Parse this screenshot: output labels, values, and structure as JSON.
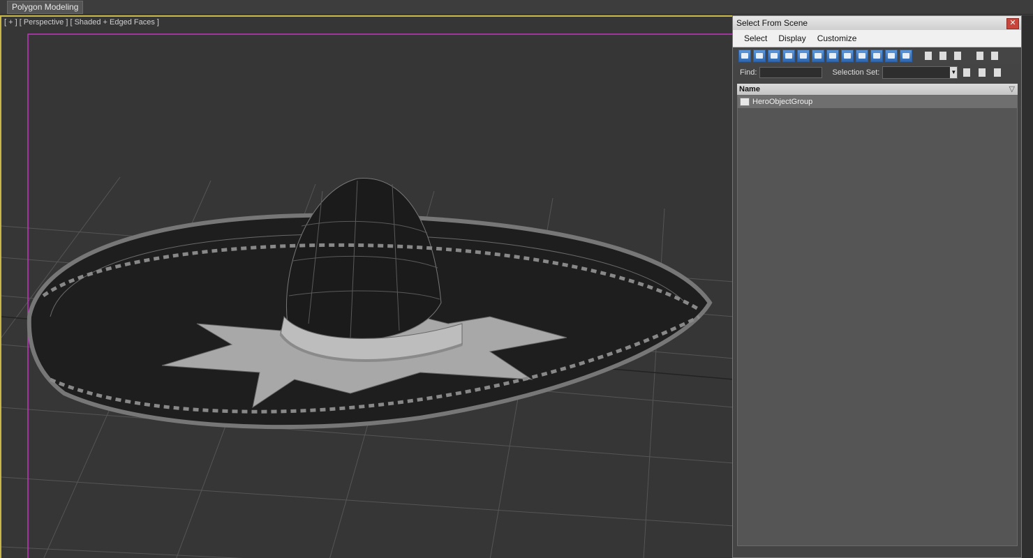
{
  "ribbon": {
    "active_tab": "Polygon Modeling"
  },
  "viewport": {
    "label": "[ + ] [ Perspective ] [ Shaded + Edged Faces ]"
  },
  "dialog": {
    "title": "Select From Scene",
    "close": "✕",
    "menus": [
      "Select",
      "Display",
      "Customize"
    ],
    "find_label": "Find:",
    "find_value": "",
    "selection_set_label": "Selection Set:",
    "selection_set_value": "",
    "column_header": "Name",
    "rows": [
      {
        "label": "HeroObjectGroup",
        "icon": "group-icon"
      }
    ]
  },
  "colors": {
    "accent": "#c9b847",
    "frame": "#c036c0",
    "selected_row": "#6f6f6f"
  }
}
